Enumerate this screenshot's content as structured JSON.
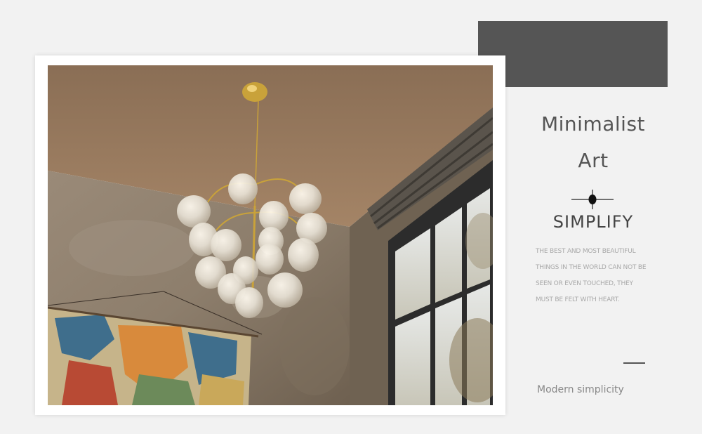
{
  "heading": {
    "line1": "Minimalist",
    "line2": "Art"
  },
  "subtitle": "SIMPLIFY",
  "description": [
    "THE BEST AND MOST BEAUTIFUL",
    "THINGS IN THE WORLD CAN NOT BE",
    "SEEN OR EVEN TOUCHED, THEY",
    "MUST BE FELT WITH HEART."
  ],
  "tagline": "Modern simplicity",
  "colors": {
    "background": "#f2f2f2",
    "accent_block": "#555555",
    "frame": "#ffffff",
    "heading_text": "#555555"
  },
  "photo": {
    "subject": "gold chandelier with glass bubble shades",
    "icons": [
      "chandelier-icon",
      "map-icon",
      "window-icon"
    ]
  }
}
